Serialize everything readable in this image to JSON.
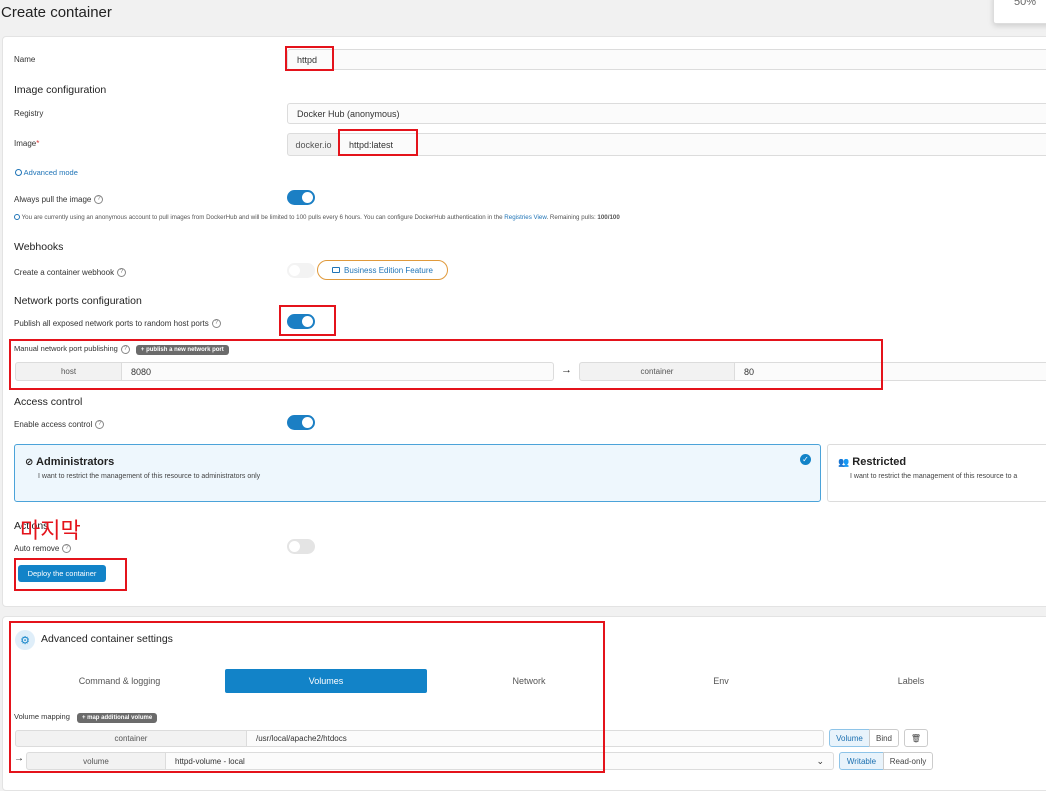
{
  "page": {
    "title": "Create container",
    "zoom": "50%"
  },
  "name_field": {
    "label": "Name",
    "value": "httpd"
  },
  "image_config": {
    "heading": "Image configuration",
    "registry_label": "Registry",
    "registry_value": "Docker Hub (anonymous)",
    "image_label": "Image",
    "image_required": "*",
    "image_prefix": "docker.io",
    "image_value": "httpd:latest",
    "advanced_mode": "Advanced mode",
    "always_pull_label": "Always pull the image",
    "info_text_before": "You are currently using an anonymous account to pull images from DockerHub and will be limited to 100 pulls every 6 hours. You can configure DockerHub authentication in the",
    "info_link": "Registries View",
    "info_text_after": ". Remaining pulls:",
    "remaining_pulls": "100/100"
  },
  "webhooks": {
    "heading": "Webhooks",
    "label": "Create a container webhook",
    "badge": "Business Edition Feature"
  },
  "network_ports": {
    "heading": "Network ports configuration",
    "publish_all_label": "Publish all exposed network ports to random host ports",
    "manual_label": "Manual network port publishing",
    "publish_button": "+ publish a new network port",
    "host_addon": "host",
    "host_value": "8080",
    "arrow": "→",
    "container_addon": "container",
    "container_value": "80"
  },
  "access_control": {
    "heading": "Access control",
    "enable_label": "Enable access control",
    "admin_title": "Administrators",
    "admin_desc": "I want to restrict the management of this resource to administrators only",
    "restricted_title": "Restricted",
    "restricted_desc": "I want to restrict the management of this resource to a"
  },
  "actions": {
    "heading": "Actions",
    "annotation": "마지막",
    "auto_remove_label": "Auto remove",
    "deploy_button": "Deploy the container"
  },
  "advanced": {
    "heading": "Advanced container settings",
    "tabs": [
      "Command & logging",
      "Volumes",
      "Network",
      "Env",
      "Labels"
    ],
    "volume_mapping_label": "Volume mapping",
    "map_button": "+ map additional volume",
    "container_addon": "container",
    "container_path": "/usr/local/apache2/htdocs",
    "volume_btn": "Volume",
    "bind_btn": "Bind",
    "arrow": "→",
    "volume_addon": "volume",
    "volume_value": "httpd-volume - local",
    "writable_btn": "Writable",
    "readonly_btn": "Read-only"
  },
  "colors": {
    "accent": "#1283c8",
    "annotation_red": "#e4131b",
    "badge_orange": "#e09a3c"
  }
}
